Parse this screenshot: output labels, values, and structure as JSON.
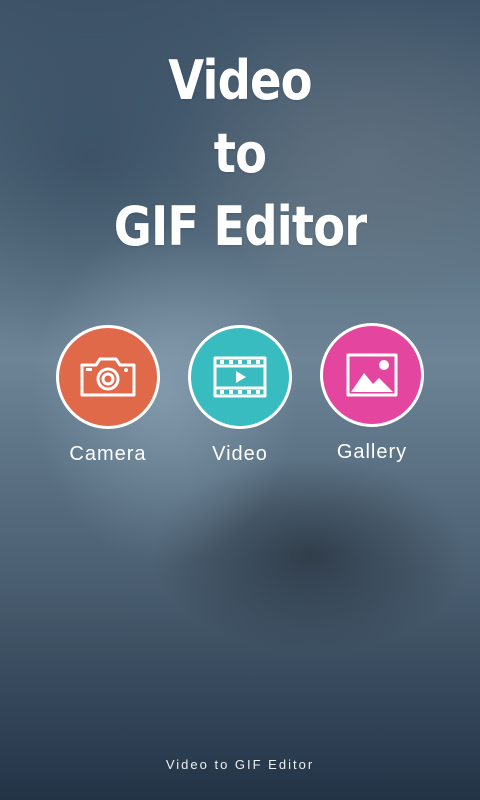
{
  "title": {
    "line1": "Video",
    "line2": "to",
    "line3": "GIF Editor"
  },
  "actions": [
    {
      "label": "Camera",
      "icon": "camera-icon",
      "color": "#e0694a"
    },
    {
      "label": "Video",
      "icon": "video-film-icon",
      "color": "#38bcc0"
    },
    {
      "label": "Gallery",
      "icon": "image-gallery-icon",
      "color": "#e4469f"
    }
  ],
  "footer": {
    "text": "Video to GIF Editor"
  }
}
